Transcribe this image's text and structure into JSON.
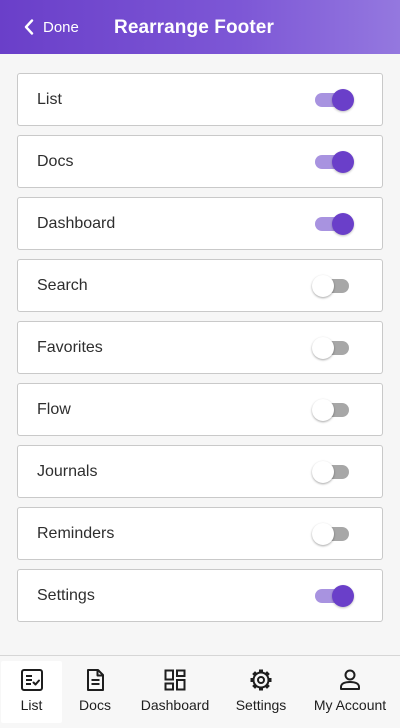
{
  "header": {
    "back_label": "Done",
    "title": "Rearrange Footer",
    "gradient_start": "#6a3fc9",
    "gradient_end": "#9478df"
  },
  "accent_color": "#6a3fc9",
  "items": [
    {
      "label": "List",
      "enabled": true
    },
    {
      "label": "Docs",
      "enabled": true
    },
    {
      "label": "Dashboard",
      "enabled": true
    },
    {
      "label": "Search",
      "enabled": false
    },
    {
      "label": "Favorites",
      "enabled": false
    },
    {
      "label": "Flow",
      "enabled": false
    },
    {
      "label": "Journals",
      "enabled": false
    },
    {
      "label": "Reminders",
      "enabled": false
    },
    {
      "label": "Settings",
      "enabled": true
    }
  ],
  "footer": {
    "tabs": [
      {
        "label": "List",
        "icon": "checklist-icon",
        "active": true
      },
      {
        "label": "Docs",
        "icon": "document-icon",
        "active": false
      },
      {
        "label": "Dashboard",
        "icon": "dashboard-icon",
        "active": false
      },
      {
        "label": "Settings",
        "icon": "gear-icon",
        "active": false
      },
      {
        "label": "My Account",
        "icon": "user-icon",
        "active": false
      }
    ]
  }
}
